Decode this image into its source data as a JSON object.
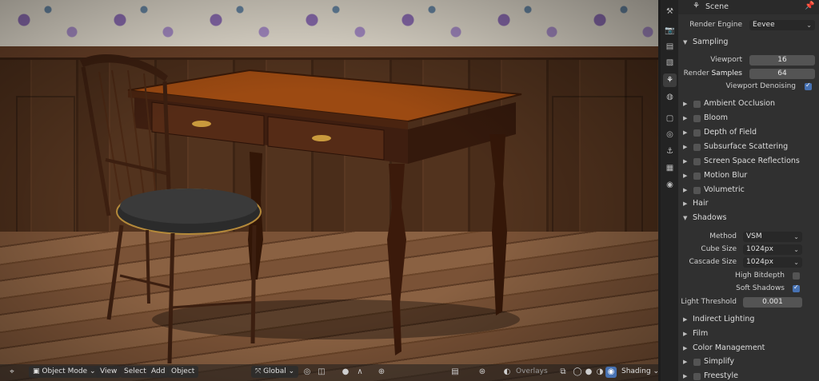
{
  "viewport": {
    "header": {
      "mode": "Object Mode",
      "menus": [
        "View",
        "Select",
        "Add",
        "Object"
      ],
      "transform_orientation": "Global",
      "overlays_label": "Overlays",
      "shading_label": "Shading"
    }
  },
  "properties": {
    "title": "Scene",
    "render_engine_label": "Render Engine",
    "render_engine_value": "Eevee",
    "sampling": {
      "title": "Sampling",
      "viewport_samples_label": "Viewport Samples",
      "viewport_samples_value": "16",
      "render_samples_label": "Render Samples",
      "render_samples_value": "64",
      "denoising_label": "Viewport Denoising",
      "denoising_checked": true
    },
    "panels_a": [
      {
        "label": "Ambient Occlusion",
        "checked": false
      },
      {
        "label": "Bloom",
        "checked": false
      },
      {
        "label": "Depth of Field",
        "checked": false
      },
      {
        "label": "Subsurface Scattering",
        "checked": false
      },
      {
        "label": "Screen Space Reflections",
        "checked": false
      },
      {
        "label": "Motion Blur",
        "checked": false
      },
      {
        "label": "Volumetric",
        "checked": false
      }
    ],
    "hair_title": "Hair",
    "shadows": {
      "title": "Shadows",
      "method_label": "Method",
      "method_value": "VSM",
      "cube_label": "Cube Size",
      "cube_value": "1024px",
      "cascade_label": "Cascade Size",
      "cascade_value": "1024px",
      "high_bitdepth_label": "High Bitdepth",
      "high_bitdepth_checked": false,
      "soft_shadows_label": "Soft Shadows",
      "soft_shadows_checked": true,
      "light_threshold_label": "Light Threshold",
      "light_threshold_value": "0.001"
    },
    "panels_b": [
      {
        "label": "Indirect Lighting"
      },
      {
        "label": "Film"
      },
      {
        "label": "Color Management"
      }
    ],
    "panels_c": [
      {
        "label": "Simplify",
        "checked": false
      },
      {
        "label": "Freestyle",
        "checked": false
      }
    ]
  }
}
